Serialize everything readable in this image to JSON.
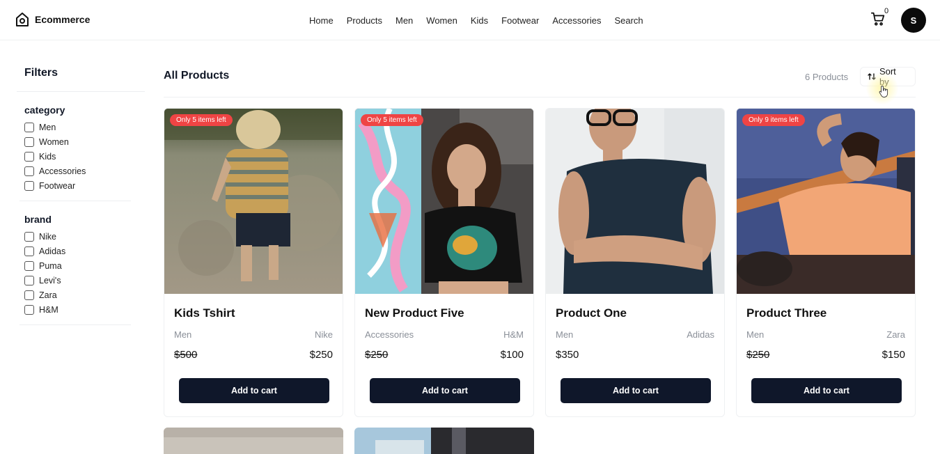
{
  "header": {
    "brand": "Ecommerce",
    "nav": [
      "Home",
      "Products",
      "Men",
      "Women",
      "Kids",
      "Footwear",
      "Accessories",
      "Search"
    ],
    "cart_count": "0",
    "avatar_initial": "S"
  },
  "sidebar": {
    "title": "Filters",
    "category": {
      "title": "category",
      "options": [
        "Men",
        "Women",
        "Kids",
        "Accessories",
        "Footwear"
      ]
    },
    "brand": {
      "title": "brand",
      "options": [
        "Nike",
        "Adidas",
        "Puma",
        "Levi's",
        "Zara",
        "H&M"
      ]
    }
  },
  "main": {
    "title": "All Products",
    "count": "6 Products",
    "sort_label": "Sort by"
  },
  "products": [
    {
      "name": "Kids Tshirt",
      "category": "Men",
      "brand": "Nike",
      "price_old": "$500",
      "price": "$250",
      "badge": "Only 5 items left",
      "button": "Add to cart"
    },
    {
      "name": "New Product Five",
      "category": "Accessories",
      "brand": "H&M",
      "price_old": "$250",
      "price": "$100",
      "badge": "Only 5 items left",
      "button": "Add to cart"
    },
    {
      "name": "Product One",
      "category": "Men",
      "brand": "Adidas",
      "price_old": "",
      "price": "$350",
      "badge": "",
      "button": "Add to cart"
    },
    {
      "name": "Product Three",
      "category": "Men",
      "brand": "Zara",
      "price_old": "$250",
      "price": "$150",
      "badge": "Only 9 items left",
      "button": "Add to cart"
    }
  ],
  "colors": {
    "primary_button": "#0f172a",
    "badge": "#ef4444",
    "muted_text": "#8a8f98"
  }
}
